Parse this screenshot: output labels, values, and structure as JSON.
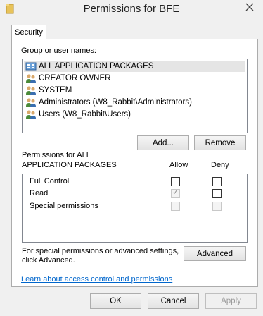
{
  "window": {
    "title": "Permissions for BFE"
  },
  "tabs": [
    {
      "label": "Security"
    }
  ],
  "group_section": {
    "label": "Group or user names:",
    "items": [
      {
        "name": "ALL APPLICATION PACKAGES",
        "selected": true
      },
      {
        "name": "CREATOR OWNER"
      },
      {
        "name": "SYSTEM"
      },
      {
        "name": "Administrators (W8_Rabbit\\Administrators)"
      },
      {
        "name": "Users (W8_Rabbit\\Users)"
      }
    ]
  },
  "buttons": {
    "add": "Add...",
    "remove": "Remove",
    "advanced": "Advanced",
    "ok": "OK",
    "cancel": "Cancel",
    "apply": "Apply"
  },
  "permissions": {
    "title_line1": "Permissions for ALL",
    "title_line2": "APPLICATION PACKAGES",
    "allow_header": "Allow",
    "deny_header": "Deny",
    "rows": [
      {
        "name": "Full Control",
        "allow": false,
        "deny": false
      },
      {
        "name": "Read",
        "allow": true,
        "deny": false
      },
      {
        "name": "Special permissions",
        "allow": false,
        "deny": false
      }
    ]
  },
  "advanced_text": {
    "line1": "For special permissions or advanced settings,",
    "line2": "click Advanced."
  },
  "link": {
    "label": "Learn about access control and permissions"
  },
  "colors": {
    "link": "#0066cc",
    "selection": "#e5e5e5"
  }
}
